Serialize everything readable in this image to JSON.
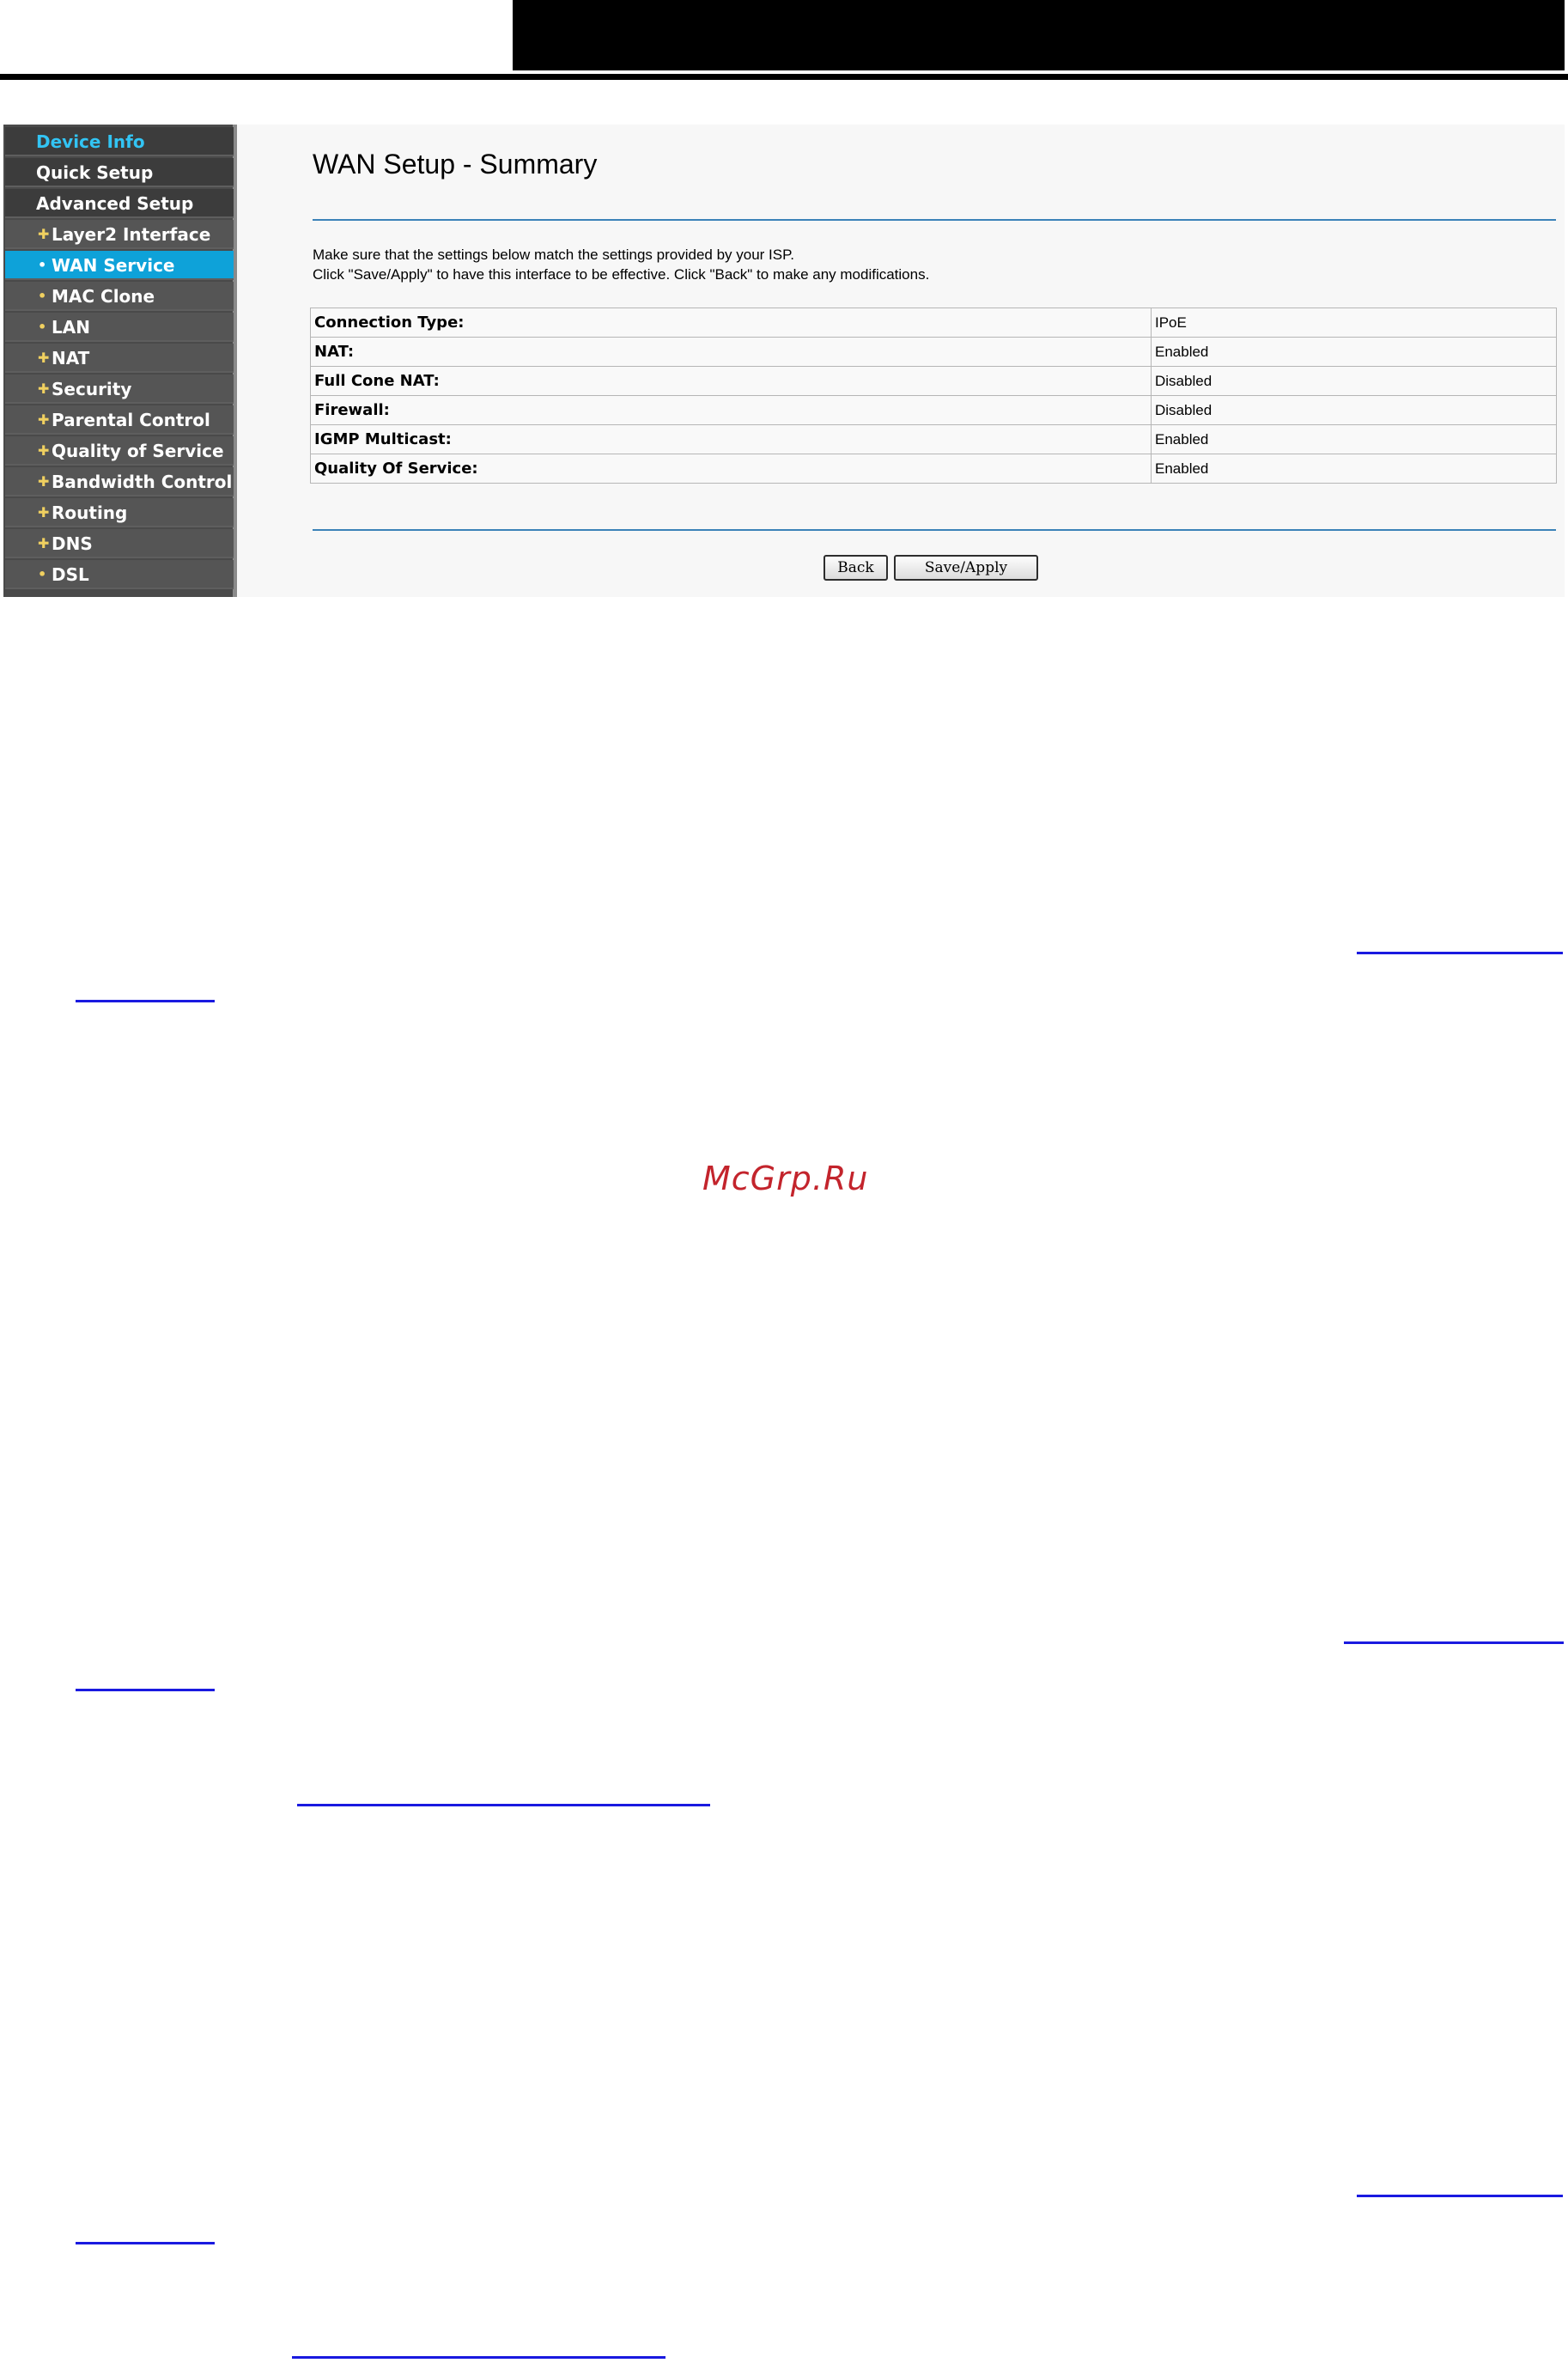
{
  "sidebar": {
    "items": [
      {
        "label": "Device Info",
        "kind": "top",
        "state": "header-link"
      },
      {
        "label": "Quick Setup",
        "kind": "top",
        "state": "normal"
      },
      {
        "label": "Advanced Setup",
        "kind": "top",
        "state": "normal"
      },
      {
        "label": "Layer2 Interface",
        "kind": "sub",
        "state": "normal",
        "bullet": "plus"
      },
      {
        "label": "WAN Service",
        "kind": "sub",
        "state": "active",
        "bullet": "dot"
      },
      {
        "label": "MAC Clone",
        "kind": "sub",
        "state": "normal",
        "bullet": "dot"
      },
      {
        "label": "LAN",
        "kind": "sub",
        "state": "normal",
        "bullet": "dot"
      },
      {
        "label": "NAT",
        "kind": "sub",
        "state": "normal",
        "bullet": "plus"
      },
      {
        "label": "Security",
        "kind": "sub",
        "state": "normal",
        "bullet": "plus"
      },
      {
        "label": "Parental Control",
        "kind": "sub",
        "state": "normal",
        "bullet": "plus"
      },
      {
        "label": "Quality of Service",
        "kind": "sub",
        "state": "normal",
        "bullet": "plus"
      },
      {
        "label": "Bandwidth Control",
        "kind": "sub",
        "state": "normal",
        "bullet": "plus"
      },
      {
        "label": "Routing",
        "kind": "sub",
        "state": "normal",
        "bullet": "plus"
      },
      {
        "label": "DNS",
        "kind": "sub",
        "state": "normal",
        "bullet": "plus"
      },
      {
        "label": "DSL",
        "kind": "sub",
        "state": "normal",
        "bullet": "dot"
      }
    ]
  },
  "main": {
    "title": "WAN Setup - Summary",
    "intro_line1": "Make sure that the settings below match the settings provided by your ISP.",
    "intro_line2": "Click \"Save/Apply\" to have this interface to be effective. Click \"Back\" to make any modifications.",
    "rows": [
      {
        "key": "Connection Type:",
        "value": "IPoE"
      },
      {
        "key": "NAT:",
        "value": "Enabled"
      },
      {
        "key": "Full Cone NAT:",
        "value": "Disabled"
      },
      {
        "key": "Firewall:",
        "value": "Disabled"
      },
      {
        "key": "IGMP Multicast:",
        "value": "Enabled"
      },
      {
        "key": "Quality Of Service:",
        "value": "Enabled"
      }
    ],
    "buttons": {
      "back": "Back",
      "save_apply": "Save/Apply"
    }
  },
  "watermark": "McGrp.Ru",
  "colors": {
    "sidebar_bg": "#4a4a4a",
    "sidebar_active": "#0ea2d9",
    "sidebar_header_link": "#32c4f4",
    "bullet": "#f0d060",
    "rule": "#3b82b8",
    "link": "#1a1ae0",
    "watermark": "#c3242c"
  }
}
